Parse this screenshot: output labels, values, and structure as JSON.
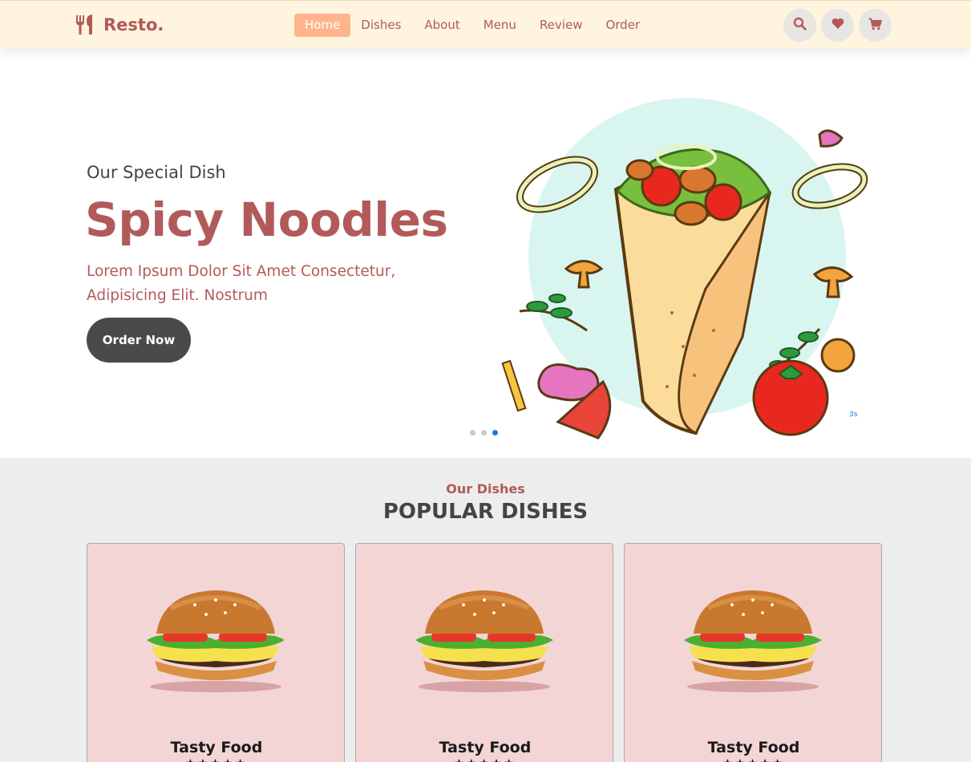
{
  "header": {
    "logo_text": "Resto.",
    "logo_icon": "utensils-icon",
    "nav": [
      {
        "label": "Home",
        "active": true
      },
      {
        "label": "Dishes",
        "active": false
      },
      {
        "label": "About",
        "active": false
      },
      {
        "label": "Menu",
        "active": false
      },
      {
        "label": "Review",
        "active": false
      },
      {
        "label": "Order",
        "active": false
      }
    ],
    "actions": [
      "search-icon",
      "heart-icon",
      "cart-icon"
    ]
  },
  "hero": {
    "subtitle": "Our Special Dish",
    "title": "Spicy Noodles",
    "description": "Lorem Ipsum Dolor Sit Amet Consectetur, Adipisicing Elit. Nostrum",
    "button_label": "Order Now",
    "slide_count": 3,
    "active_slide": 3,
    "timer": "3s"
  },
  "dishes": {
    "subtitle": "Our Dishes",
    "title": "POPULAR DISHES",
    "cards": [
      {
        "name": "Tasty Food",
        "image": "burger-image",
        "rating": "★★★★★"
      },
      {
        "name": "Tasty Food",
        "image": "burger-image",
        "rating": "★★★★★"
      },
      {
        "name": "Tasty Food",
        "image": "burger-image",
        "rating": "★★★★★"
      }
    ]
  },
  "colors": {
    "brand": "#b25a5a",
    "header_bg": "#fff4dd",
    "nav_active": "#ffb48d",
    "button_dark": "#4a4a4a",
    "card_bg": "#f4d5d6",
    "section_bg": "#ededed",
    "slider_dot_active": "#1a7be0"
  }
}
